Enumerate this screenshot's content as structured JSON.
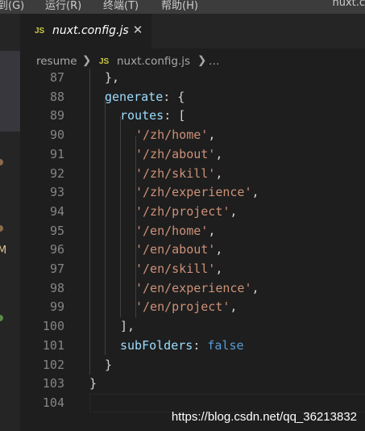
{
  "menubar": {
    "items": [
      "到(G)",
      "运行(R)",
      "终端(T)",
      "帮助(H)"
    ],
    "window_title": "nuxt.co"
  },
  "tab": {
    "icon": "JS",
    "filename": "nuxt.config.js",
    "close": "✕"
  },
  "breadcrumb": {
    "folder": "resume",
    "icon": "JS",
    "file": "nuxt.config.js",
    "more": "…"
  },
  "editor": {
    "lines": [
      {
        "num": "87"
      },
      {
        "num": "88"
      },
      {
        "num": "89"
      },
      {
        "num": "90"
      },
      {
        "num": "91"
      },
      {
        "num": "92"
      },
      {
        "num": "93"
      },
      {
        "num": "94"
      },
      {
        "num": "95"
      },
      {
        "num": "96"
      },
      {
        "num": "97"
      },
      {
        "num": "98"
      },
      {
        "num": "99"
      },
      {
        "num": "100"
      },
      {
        "num": "101"
      },
      {
        "num": "102"
      },
      {
        "num": "103"
      },
      {
        "num": "104"
      }
    ],
    "code": {
      "l87": "},",
      "generate_key": "generate",
      "routes_key": "routes",
      "routes": [
        "'/zh/home'",
        "'/zh/about'",
        "'/zh/skill'",
        "'/zh/experience'",
        "'/zh/project'",
        "'/en/home'",
        "'/en/about'",
        "'/en/skill'",
        "'/en/experience'",
        "'/en/project'"
      ],
      "l100": "],",
      "subfolders_key": "subFolders",
      "subfolders_value": "false",
      "l102": "}",
      "l103": "}"
    }
  },
  "sidebar": {
    "letter": "M"
  },
  "watermark": "https://blog.csdn.net/qq_36213832",
  "colors": {
    "background": "#1e1e1e",
    "keyword_blue": "#569cd6",
    "property": "#9cdcfe",
    "string": "#ce9178",
    "js_badge": "#cbcb41"
  }
}
